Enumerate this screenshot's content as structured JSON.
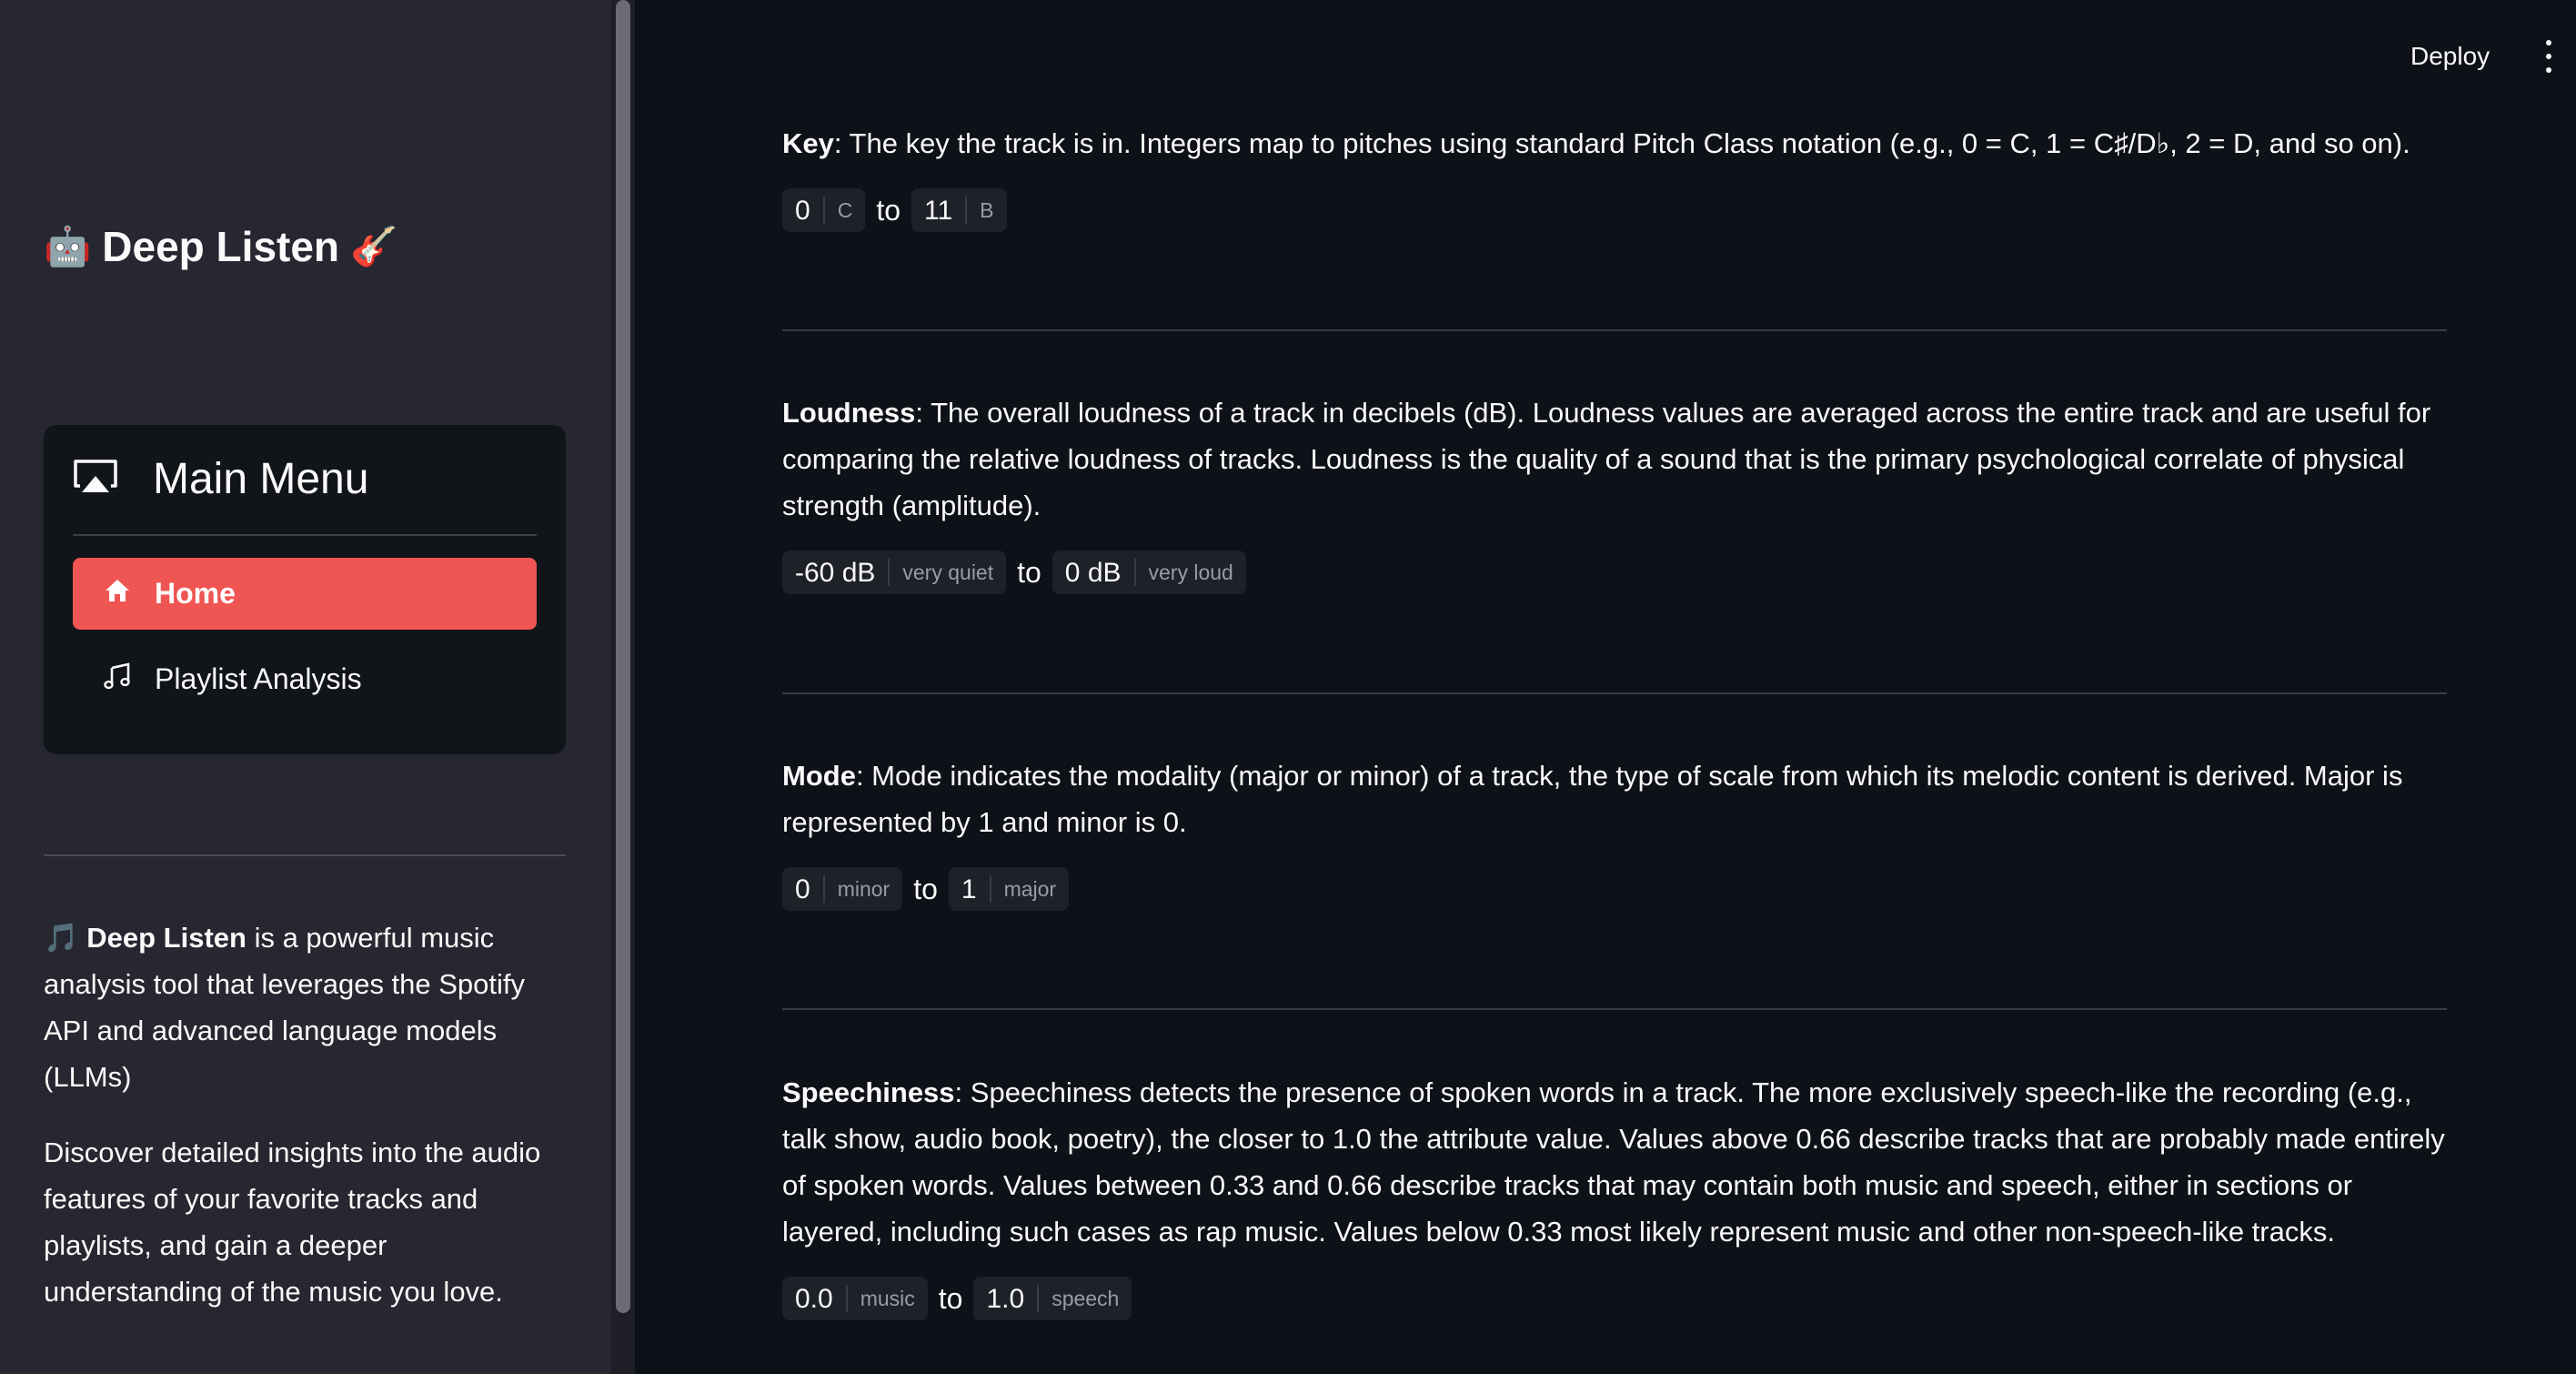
{
  "sidebar": {
    "app_title": "Deep Listen",
    "robot_emoji": "🤖",
    "guitar_emoji": "🎸",
    "menu": {
      "title": "Main Menu",
      "items": [
        {
          "label": "Home",
          "icon": "house-icon",
          "active": true
        },
        {
          "label": "Playlist Analysis",
          "icon": "music-note-icon",
          "active": false
        }
      ]
    },
    "about": {
      "note_emoji": "🎵",
      "app_name": "Deep Listen",
      "intro_rest": " is a powerful music analysis tool that leverages the Spotify API and advanced language models (LLMs)",
      "paragraph2": "Discover detailed insights into the audio features of your favorite tracks and playlists, and gain a deeper understanding of the music you love."
    }
  },
  "header": {
    "deploy_label": "Deploy"
  },
  "main": {
    "to_label": "to",
    "sections": [
      {
        "term": "Key",
        "description": ": The key the track is in. Integers map to pitches using standard Pitch Class notation (e.g., 0 = C, 1 = C♯/D♭, 2 = D, and so on).",
        "min": {
          "value": "0",
          "label": "C"
        },
        "max": {
          "value": "11",
          "label": "B"
        }
      },
      {
        "term": "Loudness",
        "description": ": The overall loudness of a track in decibels (dB). Loudness values are averaged across the entire track and are useful for comparing the relative loudness of tracks. Loudness is the quality of a sound that is the primary psychological correlate of physical strength (amplitude).",
        "min": {
          "value": "-60 dB",
          "label": "very quiet"
        },
        "max": {
          "value": "0 dB",
          "label": "very loud"
        }
      },
      {
        "term": "Mode",
        "description": ": Mode indicates the modality (major or minor) of a track, the type of scale from which its melodic content is derived. Major is represented by 1 and minor is 0.",
        "min": {
          "value": "0",
          "label": "minor"
        },
        "max": {
          "value": "1",
          "label": "major"
        }
      },
      {
        "term": "Speechiness",
        "description": ": Speechiness detects the presence of spoken words in a track. The more exclusively speech-like the recording (e.g., talk show, audio book, poetry), the closer to 1.0 the attribute value. Values above 0.66 describe tracks that are probably made entirely of spoken words. Values between 0.33 and 0.66 describe tracks that may contain both music and speech, either in sections or layered, including such cases as rap music. Values below 0.33 most likely represent music and other non-speech-like tracks.",
        "min": {
          "value": "0.0",
          "label": "music"
        },
        "max": {
          "value": "1.0",
          "label": "speech"
        }
      }
    ]
  },
  "colors": {
    "accent": "#ef5552",
    "background": "#0e1117",
    "sidebar": "#262730"
  }
}
